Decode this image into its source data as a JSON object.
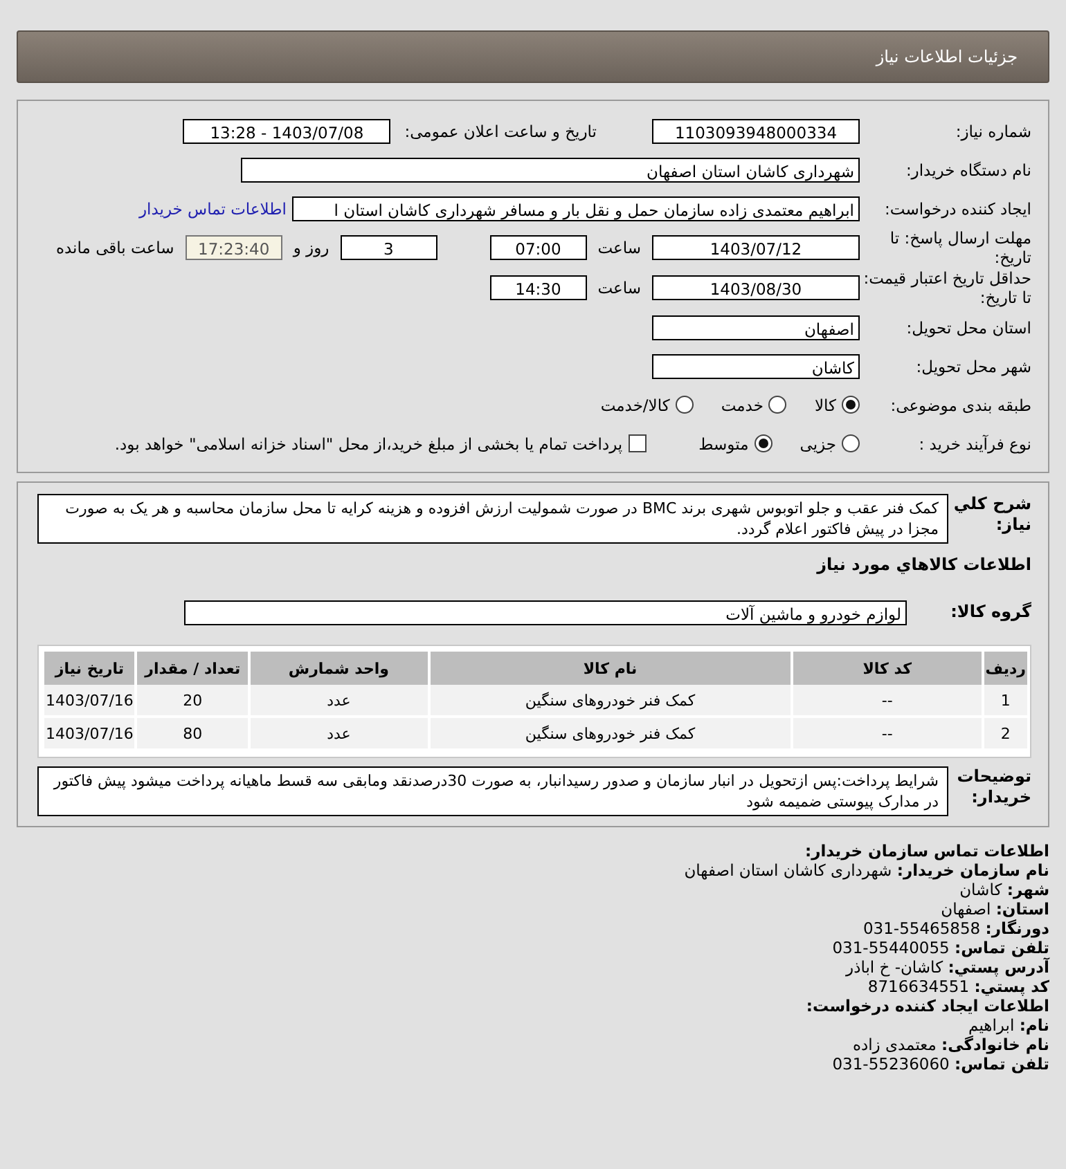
{
  "header": {
    "title": "جزئیات اطلاعات نیاز"
  },
  "info": {
    "need_number": {
      "label": "شماره نیاز:",
      "value": "1103093948000334"
    },
    "announce": {
      "label": "تاریخ و ساعت اعلان عمومی:",
      "value": "1403/07/08 - 13:28"
    },
    "buyer": {
      "label": "نام دستگاه خریدار:",
      "value": "شهرداری کاشان استان اصفهان"
    },
    "creator": {
      "label": "ایجاد کننده درخواست:",
      "value": "ابراهیم معتمدی زاده سازمان حمل و نقل بار و مسافر شهرداری کاشان استان ا",
      "link": "اطلاعات تماس خریدار"
    },
    "deadline": {
      "label": "مهلت ارسال پاسخ: تا تاریخ:",
      "date": "1403/07/12",
      "time_label": "ساعت",
      "time": "07:00",
      "days": "3",
      "days_label": "روز و",
      "remaining": "17:23:40",
      "remaining_label": "ساعت باقی مانده"
    },
    "validity": {
      "label": "حداقل تاریخ اعتبار قیمت: تا تاریخ:",
      "date": "1403/08/30",
      "time_label": "ساعت",
      "time": "14:30"
    },
    "province": {
      "label": "استان محل تحویل:",
      "value": "اصفهان"
    },
    "city": {
      "label": "شهر محل تحویل:",
      "value": "کاشان"
    },
    "category": {
      "label": "طبقه بندی موضوعی:",
      "options": [
        {
          "label": "کالا",
          "selected": true
        },
        {
          "label": "خدمت",
          "selected": false
        },
        {
          "label": "کالا/خدمت",
          "selected": false
        }
      ]
    },
    "process": {
      "label": "نوع فرآیند خرید :",
      "options": [
        {
          "label": "جزیی",
          "selected": false
        },
        {
          "label": "متوسط",
          "selected": true
        }
      ],
      "payment": {
        "label": "پرداخت تمام یا بخشی از مبلغ خرید،از محل \"اسناد خزانه اسلامی\" خواهد بود.",
        "checked": false
      }
    }
  },
  "details": {
    "description": {
      "label": "شرح کلي نياز:",
      "value": "کمک فنر عقب و جلو اتوبوس شهری برند BMC در صورت شمولیت ارزش افزوده و هزینه کرایه تا محل سازمان محاسبه و هر یک به صورت مجزا در پیش فاکتور اعلام گردد."
    },
    "goods_title": "اطلاعات کالاهاي مورد نياز",
    "group": {
      "label": "گروه کالا:",
      "value": "لوازم خودرو و ماشین آلات"
    },
    "table": {
      "columns": [
        "ردیف",
        "کد کالا",
        "نام کالا",
        "واحد شمارش",
        "تعداد / مقدار",
        "تاریخ نیاز"
      ],
      "rows": [
        [
          "1",
          "--",
          "کمک فنر خودروهای سنگین",
          "عدد",
          "20",
          "1403/07/16"
        ],
        [
          "2",
          "--",
          "کمک فنر خودروهای سنگین",
          "عدد",
          "80",
          "1403/07/16"
        ]
      ]
    },
    "notes": {
      "label": "توضیحات خریدار:",
      "value": "شرایط پرداخت:پس ازتحویل در انبار سازمان و صدور رسیدانبار، به صورت 30درصدنقد ومابقی سه قسط ماهیانه پرداخت میشود پیش فاکتور در مدارک پیوستی ضمیمه شود"
    }
  },
  "contact": [
    {
      "kind": "heading",
      "label": "اطلاعات تماس سازمان خریدار:"
    },
    {
      "kind": "field",
      "label": "نام سازمان خریدار:",
      "value": "شهرداری کاشان استان اصفهان"
    },
    {
      "kind": "field",
      "label": "شهر:",
      "value": "کاشان"
    },
    {
      "kind": "field",
      "label": "استان:",
      "value": "اصفهان"
    },
    {
      "kind": "field",
      "label": "دورنگار:",
      "value": "55465858-031"
    },
    {
      "kind": "field",
      "label": "تلفن تماس:",
      "value": "55440055-031"
    },
    {
      "kind": "field",
      "label": "آدرس پستي:",
      "value": "کاشان- خ اباذر"
    },
    {
      "kind": "field",
      "label": "کد پستي:",
      "value": "8716634551"
    },
    {
      "kind": "heading",
      "label": "اطلاعات ایجاد کننده درخواست:"
    },
    {
      "kind": "field",
      "label": "نام:",
      "value": "ابراهیم"
    },
    {
      "kind": "field",
      "label": "نام خانوادگی:",
      "value": "معتمدی زاده"
    },
    {
      "kind": "field",
      "label": "تلفن تماس:",
      "value": "55236060-031"
    }
  ]
}
